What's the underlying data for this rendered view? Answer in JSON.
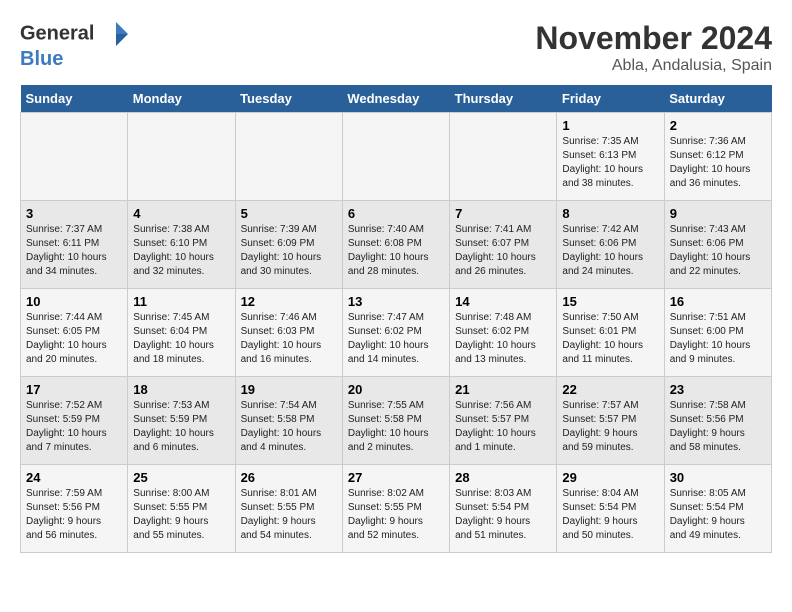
{
  "logo": {
    "line1": "General",
    "line2": "Blue"
  },
  "title": "November 2024",
  "subtitle": "Abla, Andalusia, Spain",
  "weekdays": [
    "Sunday",
    "Monday",
    "Tuesday",
    "Wednesday",
    "Thursday",
    "Friday",
    "Saturday"
  ],
  "weeks": [
    [
      {
        "day": "",
        "info": ""
      },
      {
        "day": "",
        "info": ""
      },
      {
        "day": "",
        "info": ""
      },
      {
        "day": "",
        "info": ""
      },
      {
        "day": "",
        "info": ""
      },
      {
        "day": "1",
        "info": "Sunrise: 7:35 AM\nSunset: 6:13 PM\nDaylight: 10 hours\nand 38 minutes."
      },
      {
        "day": "2",
        "info": "Sunrise: 7:36 AM\nSunset: 6:12 PM\nDaylight: 10 hours\nand 36 minutes."
      }
    ],
    [
      {
        "day": "3",
        "info": "Sunrise: 7:37 AM\nSunset: 6:11 PM\nDaylight: 10 hours\nand 34 minutes."
      },
      {
        "day": "4",
        "info": "Sunrise: 7:38 AM\nSunset: 6:10 PM\nDaylight: 10 hours\nand 32 minutes."
      },
      {
        "day": "5",
        "info": "Sunrise: 7:39 AM\nSunset: 6:09 PM\nDaylight: 10 hours\nand 30 minutes."
      },
      {
        "day": "6",
        "info": "Sunrise: 7:40 AM\nSunset: 6:08 PM\nDaylight: 10 hours\nand 28 minutes."
      },
      {
        "day": "7",
        "info": "Sunrise: 7:41 AM\nSunset: 6:07 PM\nDaylight: 10 hours\nand 26 minutes."
      },
      {
        "day": "8",
        "info": "Sunrise: 7:42 AM\nSunset: 6:06 PM\nDaylight: 10 hours\nand 24 minutes."
      },
      {
        "day": "9",
        "info": "Sunrise: 7:43 AM\nSunset: 6:06 PM\nDaylight: 10 hours\nand 22 minutes."
      }
    ],
    [
      {
        "day": "10",
        "info": "Sunrise: 7:44 AM\nSunset: 6:05 PM\nDaylight: 10 hours\nand 20 minutes."
      },
      {
        "day": "11",
        "info": "Sunrise: 7:45 AM\nSunset: 6:04 PM\nDaylight: 10 hours\nand 18 minutes."
      },
      {
        "day": "12",
        "info": "Sunrise: 7:46 AM\nSunset: 6:03 PM\nDaylight: 10 hours\nand 16 minutes."
      },
      {
        "day": "13",
        "info": "Sunrise: 7:47 AM\nSunset: 6:02 PM\nDaylight: 10 hours\nand 14 minutes."
      },
      {
        "day": "14",
        "info": "Sunrise: 7:48 AM\nSunset: 6:02 PM\nDaylight: 10 hours\nand 13 minutes."
      },
      {
        "day": "15",
        "info": "Sunrise: 7:50 AM\nSunset: 6:01 PM\nDaylight: 10 hours\nand 11 minutes."
      },
      {
        "day": "16",
        "info": "Sunrise: 7:51 AM\nSunset: 6:00 PM\nDaylight: 10 hours\nand 9 minutes."
      }
    ],
    [
      {
        "day": "17",
        "info": "Sunrise: 7:52 AM\nSunset: 5:59 PM\nDaylight: 10 hours\nand 7 minutes."
      },
      {
        "day": "18",
        "info": "Sunrise: 7:53 AM\nSunset: 5:59 PM\nDaylight: 10 hours\nand 6 minutes."
      },
      {
        "day": "19",
        "info": "Sunrise: 7:54 AM\nSunset: 5:58 PM\nDaylight: 10 hours\nand 4 minutes."
      },
      {
        "day": "20",
        "info": "Sunrise: 7:55 AM\nSunset: 5:58 PM\nDaylight: 10 hours\nand 2 minutes."
      },
      {
        "day": "21",
        "info": "Sunrise: 7:56 AM\nSunset: 5:57 PM\nDaylight: 10 hours\nand 1 minute."
      },
      {
        "day": "22",
        "info": "Sunrise: 7:57 AM\nSunset: 5:57 PM\nDaylight: 9 hours\nand 59 minutes."
      },
      {
        "day": "23",
        "info": "Sunrise: 7:58 AM\nSunset: 5:56 PM\nDaylight: 9 hours\nand 58 minutes."
      }
    ],
    [
      {
        "day": "24",
        "info": "Sunrise: 7:59 AM\nSunset: 5:56 PM\nDaylight: 9 hours\nand 56 minutes."
      },
      {
        "day": "25",
        "info": "Sunrise: 8:00 AM\nSunset: 5:55 PM\nDaylight: 9 hours\nand 55 minutes."
      },
      {
        "day": "26",
        "info": "Sunrise: 8:01 AM\nSunset: 5:55 PM\nDaylight: 9 hours\nand 54 minutes."
      },
      {
        "day": "27",
        "info": "Sunrise: 8:02 AM\nSunset: 5:55 PM\nDaylight: 9 hours\nand 52 minutes."
      },
      {
        "day": "28",
        "info": "Sunrise: 8:03 AM\nSunset: 5:54 PM\nDaylight: 9 hours\nand 51 minutes."
      },
      {
        "day": "29",
        "info": "Sunrise: 8:04 AM\nSunset: 5:54 PM\nDaylight: 9 hours\nand 50 minutes."
      },
      {
        "day": "30",
        "info": "Sunrise: 8:05 AM\nSunset: 5:54 PM\nDaylight: 9 hours\nand 49 minutes."
      }
    ]
  ]
}
